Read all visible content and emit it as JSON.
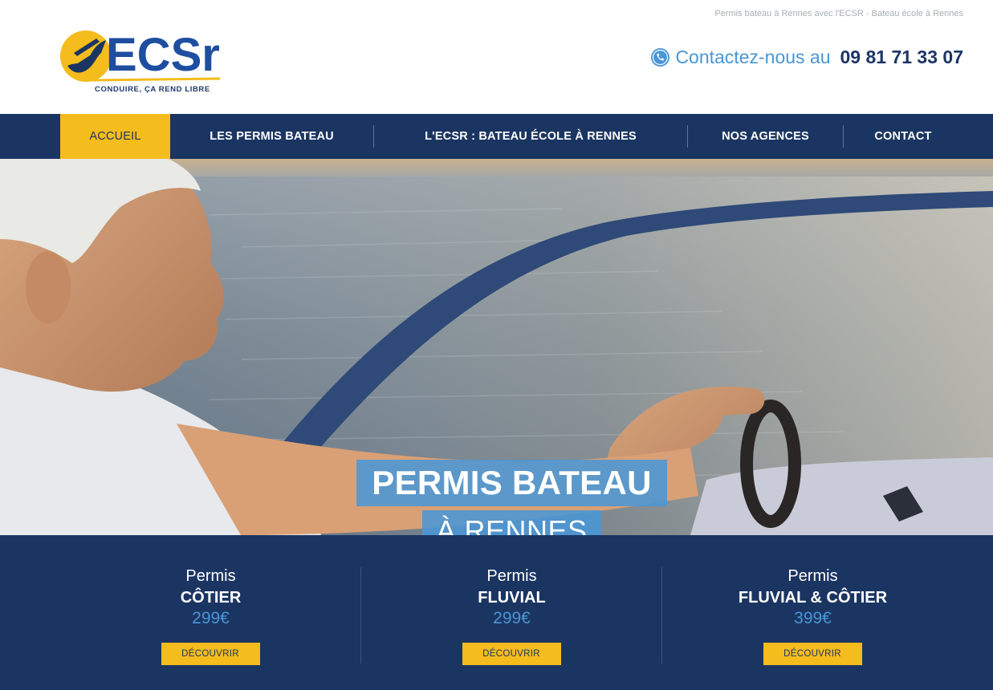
{
  "header": {
    "tagline": "Permis bateau à Rennes avec l'ECSR - Bateau école à Rennes",
    "logo_text": "ECSr",
    "logo_subtitle": "CONDUIRE, ÇA REND LIBRE",
    "contact_label": "Contactez-nous au",
    "contact_number": "09 81 71 33 07",
    "contact_icon": "phone-icon"
  },
  "nav": {
    "items": [
      {
        "label": "ACCUEIL",
        "active": true
      },
      {
        "label": "LES PERMIS BATEAU",
        "active": false
      },
      {
        "label": "L'ECSR : BATEAU ÉCOLE À RENNES",
        "active": false
      },
      {
        "label": "NOS AGENCES",
        "active": false
      },
      {
        "label": "CONTACT",
        "active": false
      }
    ]
  },
  "hero": {
    "title": "PERMIS BATEAU",
    "subtitle": "À RENNES"
  },
  "pricing": {
    "cards": [
      {
        "label": "Permis",
        "name": "CÔTIER",
        "price": "299€",
        "button": "DÉCOUVRIR"
      },
      {
        "label": "Permis",
        "name": "FLUVIAL",
        "price": "299€",
        "button": "DÉCOUVRIR"
      },
      {
        "label": "Permis",
        "name": "FLUVIAL & CÔTIER",
        "price": "399€",
        "button": "DÉCOUVRIR"
      }
    ]
  },
  "colors": {
    "navy": "#1b3562",
    "accent_yellow": "#f4bc1c",
    "accent_blue": "#4a96d6"
  }
}
